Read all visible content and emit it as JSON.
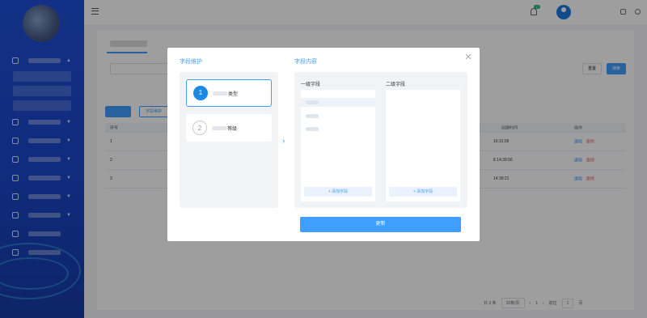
{
  "topbar": {
    "notification_count": "17"
  },
  "list": {
    "reset_label": "重置",
    "search_label": "搜索",
    "field_maintain_label": "字段维护",
    "columns": {
      "index": "序号",
      "created_at": "创建时间",
      "actions": "操作"
    },
    "rows": [
      {
        "index": "1",
        "time": "16:31:05",
        "edit": "编辑",
        "delete": "删除"
      },
      {
        "index": "2",
        "time": "8 14:39:56",
        "edit": "编辑",
        "delete": "删除"
      },
      {
        "index": "3",
        "time": "14:39:21",
        "edit": "编辑",
        "delete": "删除"
      }
    ]
  },
  "pager": {
    "total": "共 3 条",
    "page_size": "20条/页",
    "prev": "‹",
    "current": "1",
    "next": "›",
    "goto_label": "前往",
    "goto_value": "1",
    "page_unit": "页"
  },
  "modal": {
    "left_title": "字段维护",
    "right_title": "字段内容",
    "steps": [
      {
        "num": "1",
        "label": "类型"
      },
      {
        "num": "2",
        "label": "等级"
      }
    ],
    "level1_title": "一级字段",
    "level2_title": "二级字段",
    "add_field_label": "+ 添加字段",
    "update_label": "更新",
    "close_glyph": "✕",
    "arrow_glyph": "›"
  },
  "colors": {
    "primary": "#409eff",
    "sidebar": "#1e4fd8",
    "danger": "#f56c6c"
  },
  "icons": [
    "menu-icon",
    "bell-icon",
    "avatar-icon",
    "fullscreen-icon",
    "power-icon",
    "close-icon",
    "arrow-right-icon"
  ]
}
